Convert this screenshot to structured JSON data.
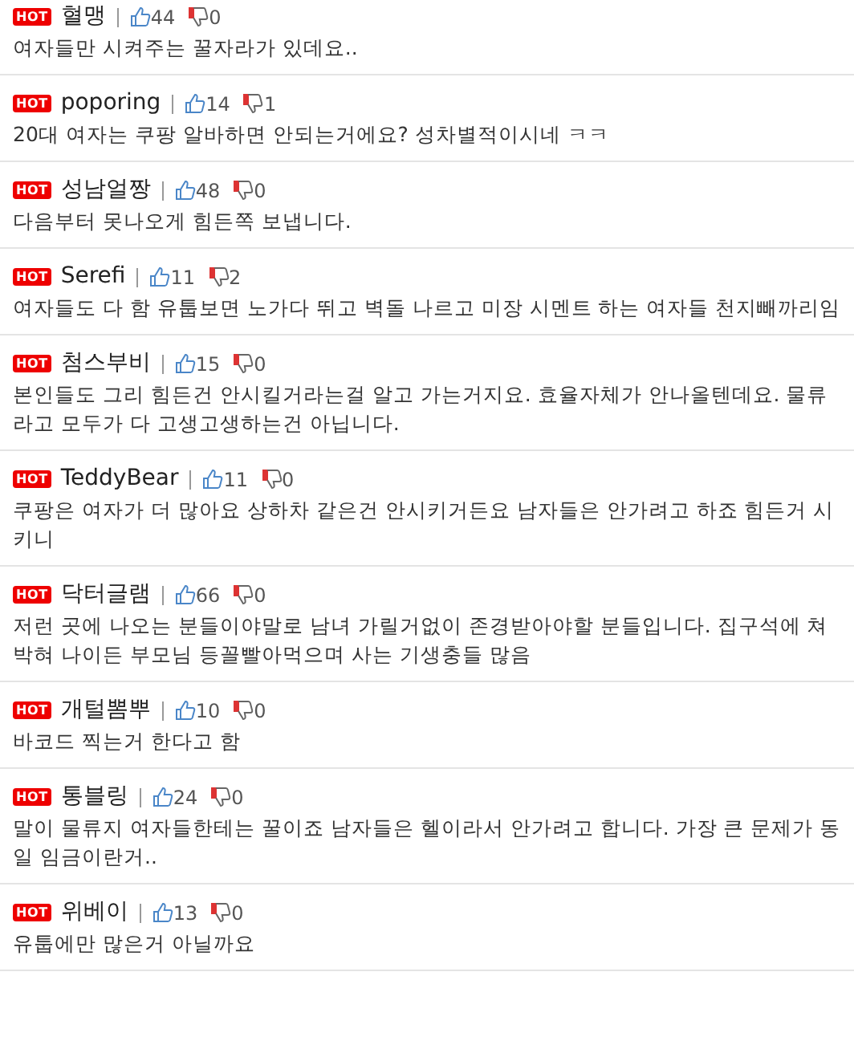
{
  "comments": [
    {
      "badge": "HOT",
      "author": "혈맹",
      "likes": "44",
      "dislikes": "0",
      "text": "여자들만 시켜주는 꿀자라가 있데요.."
    },
    {
      "badge": "HOT",
      "author": "poporing",
      "likes": "14",
      "dislikes": "1",
      "text": "20대 여자는 쿠팡 알바하면 안되는거에요? 성차별적이시네 ㅋㅋ"
    },
    {
      "badge": "HOT",
      "author": "성남얼짱",
      "likes": "48",
      "dislikes": "0",
      "text": "다음부터 못나오게 힘든쪽 보냅니다."
    },
    {
      "badge": "HOT",
      "author": "Serefi",
      "likes": "11",
      "dislikes": "2",
      "text": "여자들도 다 함 유툽보면 노가다 뛰고 벽돌 나르고 미장 시멘트 하는 여자들 천지빼까리임"
    },
    {
      "badge": "HOT",
      "author": "첨스부비",
      "likes": "15",
      "dislikes": "0",
      "text": "본인들도 그리 힘든건 안시킬거라는걸 알고 가는거지요. 효율자체가 안나올텐데요. 물류라고 모두가 다 고생고생하는건 아닙니다."
    },
    {
      "badge": "HOT",
      "author": "TeddyBear",
      "likes": "11",
      "dislikes": "0",
      "text": "쿠팡은 여자가 더 많아요 상하차 같은건 안시키거든요 남자들은 안가려고 하죠 힘든거 시키니"
    },
    {
      "badge": "HOT",
      "author": "닥터글램",
      "likes": "66",
      "dislikes": "0",
      "text": "저런 곳에 나오는 분들이야말로 남녀 가릴거없이 존경받아야할 분들입니다. 집구석에 쳐박혀 나이든 부모님 등꼴빨아먹으며 사는 기생충들 많음"
    },
    {
      "badge": "HOT",
      "author": "개털뽐뿌",
      "likes": "10",
      "dislikes": "0",
      "text": "바코드 찍는거 한다고 함"
    },
    {
      "badge": "HOT",
      "author": "통블링",
      "likes": "24",
      "dislikes": "0",
      "text": "말이 물류지 여자들한테는 꿀이죠 남자들은 헬이라서 안가려고 합니다. 가장 큰 문제가 동일 임금이란거.."
    },
    {
      "badge": "HOT",
      "author": "위베이",
      "likes": "13",
      "dislikes": "0",
      "text": "유툽에만 많은거 아닐까요"
    }
  ]
}
